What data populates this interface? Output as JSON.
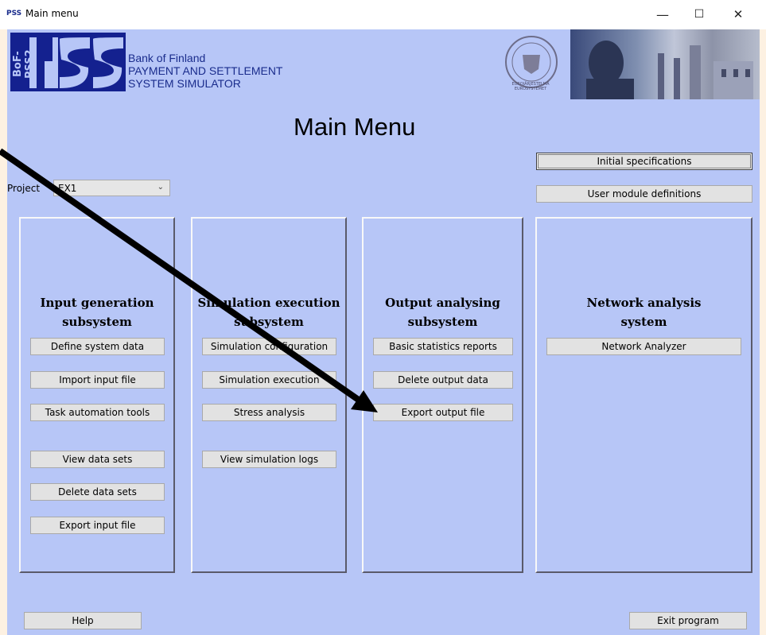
{
  "window": {
    "icon_label": "PSS",
    "title": "Main menu",
    "controls": {
      "minimize": "—",
      "maximize": "☐",
      "close": "✕"
    }
  },
  "header": {
    "logo_side_text": "BoF-PSS2",
    "logo_text": "PSS",
    "bank_lines": [
      "Bank of Finland",
      "PAYMENT AND SETTLEMENT",
      "SYSTEM SIMULATOR"
    ],
    "seal_caption": "EUROJÄRJESTELMÄ EUROSYSTEMET"
  },
  "main_title": "Main Menu",
  "project": {
    "label": "Project",
    "value": "EX1"
  },
  "top_buttons": {
    "initial_specifications": "Initial specifications",
    "user_module_definitions": "User module definitions"
  },
  "panels": {
    "input": {
      "title_line1": "Input generation",
      "title_line2": "subsystem",
      "buttons": [
        "Define system data",
        "Import input file",
        "Task automation tools",
        "View data sets",
        "Delete data sets",
        "Export input file"
      ]
    },
    "simulation": {
      "title_line1": "Simulation execution",
      "title_line2": "subsystem",
      "buttons": [
        "Simulation configuration",
        "Simulation execution",
        "Stress analysis",
        "View simulation logs"
      ]
    },
    "output": {
      "title_line1": "Output analysing",
      "title_line2": "subsystem",
      "buttons": [
        "Basic statistics reports",
        "Delete output data",
        "Export output file"
      ]
    },
    "network": {
      "title_line1": "Network analysis",
      "title_line2": "system",
      "buttons": [
        "Network Analyzer"
      ]
    }
  },
  "bottom": {
    "help": "Help",
    "exit": "Exit program"
  }
}
